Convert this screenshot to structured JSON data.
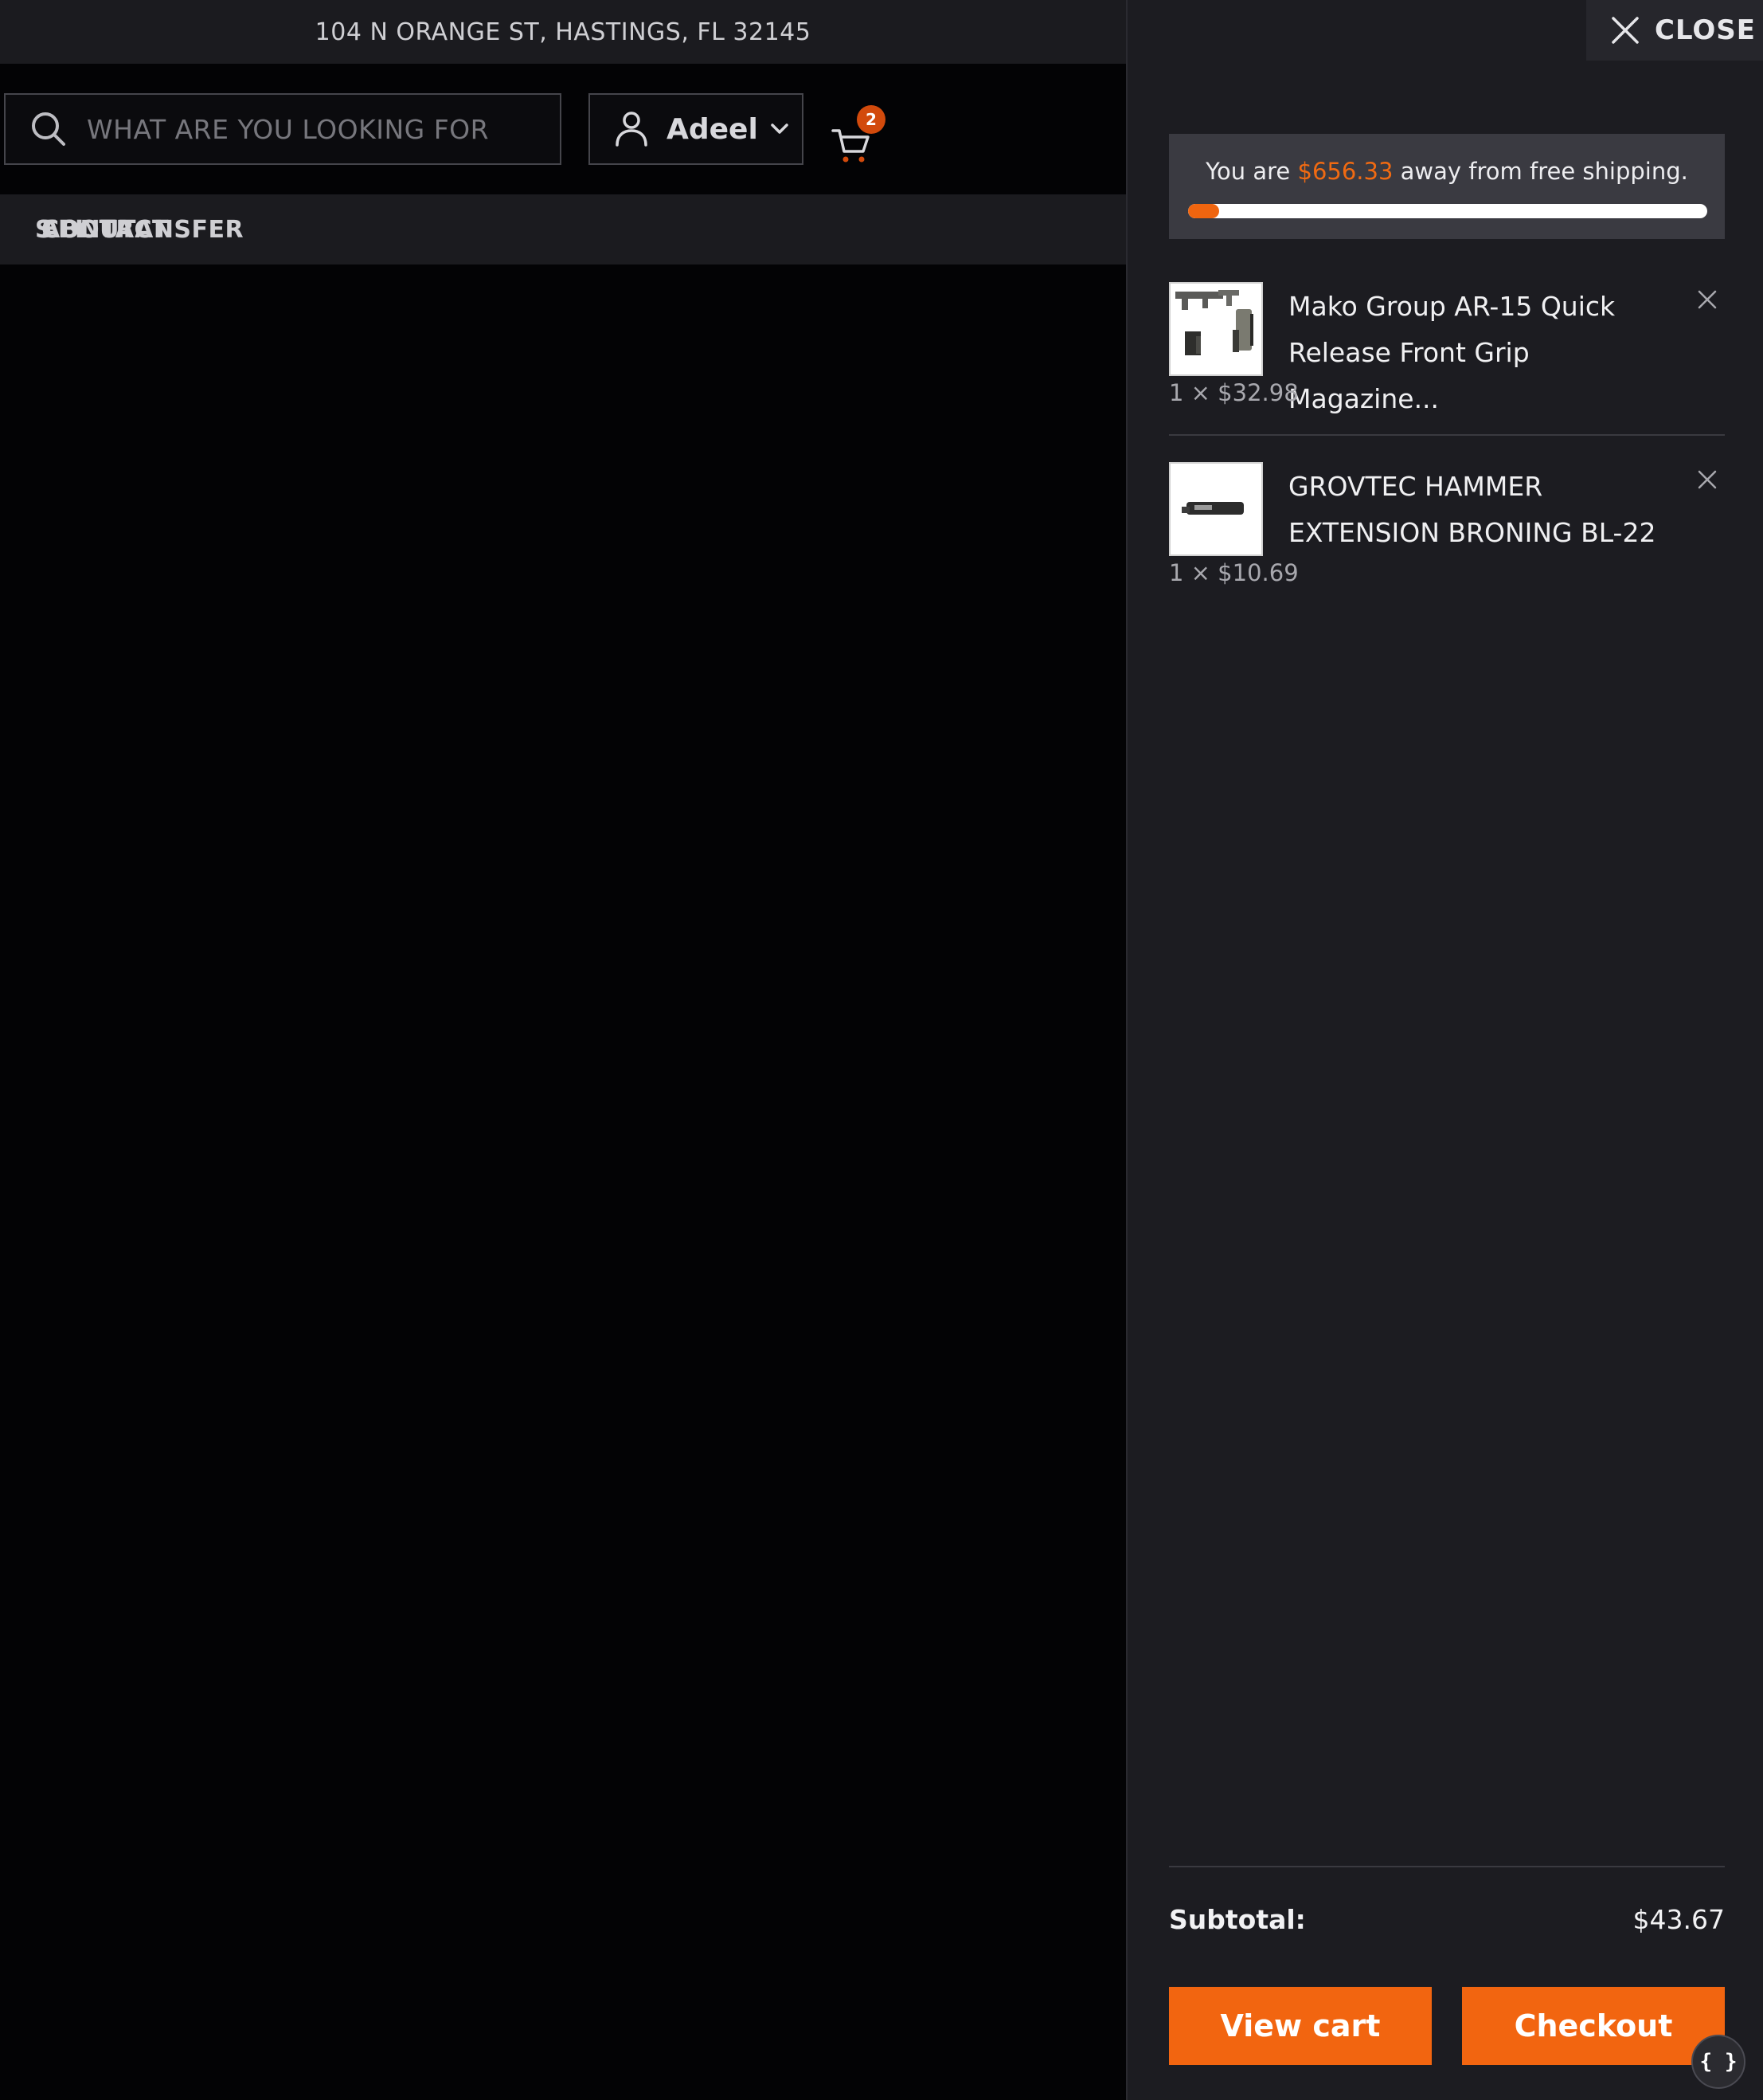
{
  "topbar": {
    "address": "104 N ORANGE ST, HASTINGS, FL 32145"
  },
  "header": {
    "search_placeholder": "WHAT ARE YOU LOOKING FOR",
    "account_name": "Adeel",
    "cart_count": "2"
  },
  "nav": {
    "items": [
      {
        "label": "S"
      },
      {
        "label": "FFL TRANSFER"
      },
      {
        "label": "ABOUT"
      },
      {
        "label": "CONTACT"
      }
    ]
  },
  "drawer": {
    "close_label": "CLOSE",
    "shipping": {
      "prefix": "You are ",
      "amount": "$656.33",
      "suffix": " away from free shipping.",
      "progress_fraction": 0.06
    },
    "items": [
      {
        "title": "Mako Group AR-15 Quick Release Front Grip Magazine...",
        "qty_price": "1 × $32.98"
      },
      {
        "title": "GROVTEC HAMMER EXTENSION BRONING BL-22",
        "qty_price": "1 × $10.69"
      }
    ],
    "subtotal_label": "Subtotal:",
    "subtotal_value": "$43.67",
    "view_cart_label": "View cart",
    "checkout_label": "Checkout"
  },
  "dev_badge": "{ }",
  "colors": {
    "accent": "#f26510",
    "drawer_bg": "#1c1c21",
    "page_bg": "#030305"
  },
  "icons": [
    "search-icon",
    "user-icon",
    "chevron-down-icon",
    "cart-icon",
    "close-icon",
    "remove-icon"
  ]
}
